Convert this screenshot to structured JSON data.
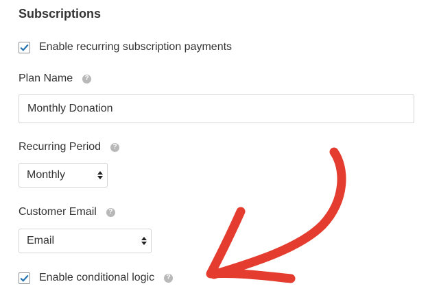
{
  "section": {
    "title": "Subscriptions"
  },
  "recurring": {
    "label": "Enable recurring subscription payments",
    "checked": true
  },
  "plan_name": {
    "label": "Plan Name",
    "value": "Monthly Donation"
  },
  "recurring_period": {
    "label": "Recurring Period",
    "selected": "Monthly"
  },
  "customer_email": {
    "label": "Customer Email",
    "selected": "Email"
  },
  "conditional_logic": {
    "label": "Enable conditional logic",
    "checked": true
  },
  "icons": {
    "help": "question-circle-icon",
    "check": "checkmark-icon",
    "select_arrows": "up-down-arrows-icon",
    "annotation": "red-curved-arrow-icon"
  },
  "colors": {
    "accent": "#2271b1",
    "annotation": "#e43d30",
    "help_icon": "#b8b8b8"
  }
}
